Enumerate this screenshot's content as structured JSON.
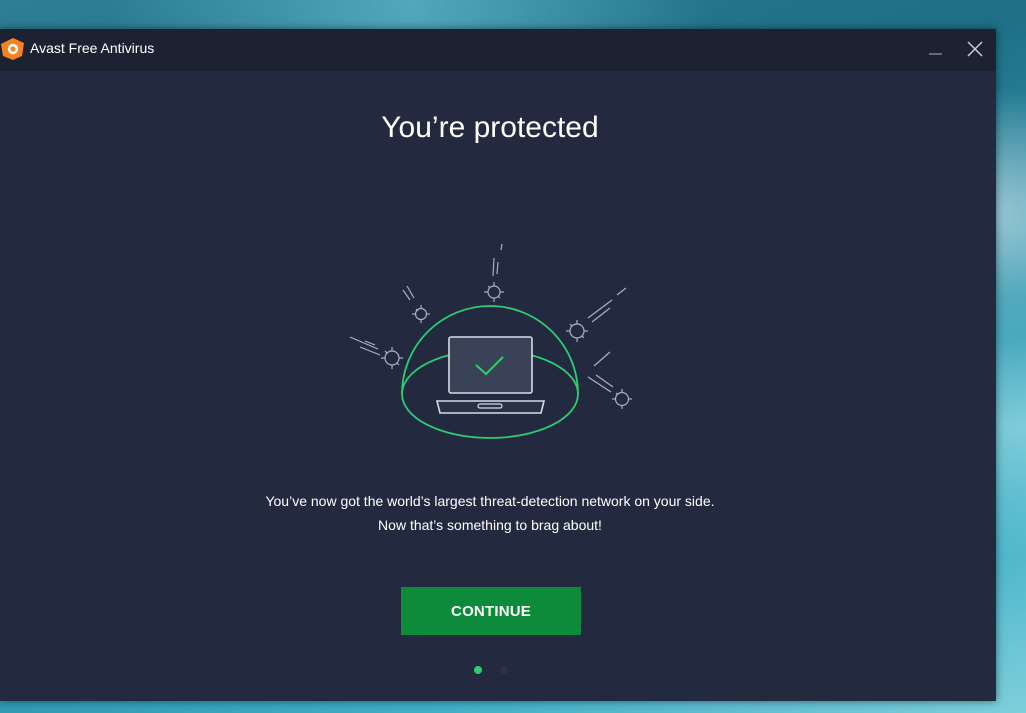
{
  "window": {
    "title": "Avast Free Antivirus"
  },
  "main": {
    "headline": "You’re protected",
    "message_line1": "You’ve now got the world’s largest threat-detection network on your side.",
    "message_line2": "Now that’s something to brag about!",
    "continue_label": "CONTINUE"
  },
  "pagination": {
    "current_page": 1,
    "total_pages": 2
  },
  "colors": {
    "window_bg": "#232a3f",
    "titlebar_bg": "#1d2233",
    "accent_green": "#0d8a3a",
    "dome_green": "#2ecc71",
    "logo_orange": "#f5821f"
  },
  "icons": {
    "logo": "avast-logo-icon",
    "minimize": "minimize-icon",
    "close": "close-icon",
    "illustration": "protected-laptop-dome-illustration"
  }
}
